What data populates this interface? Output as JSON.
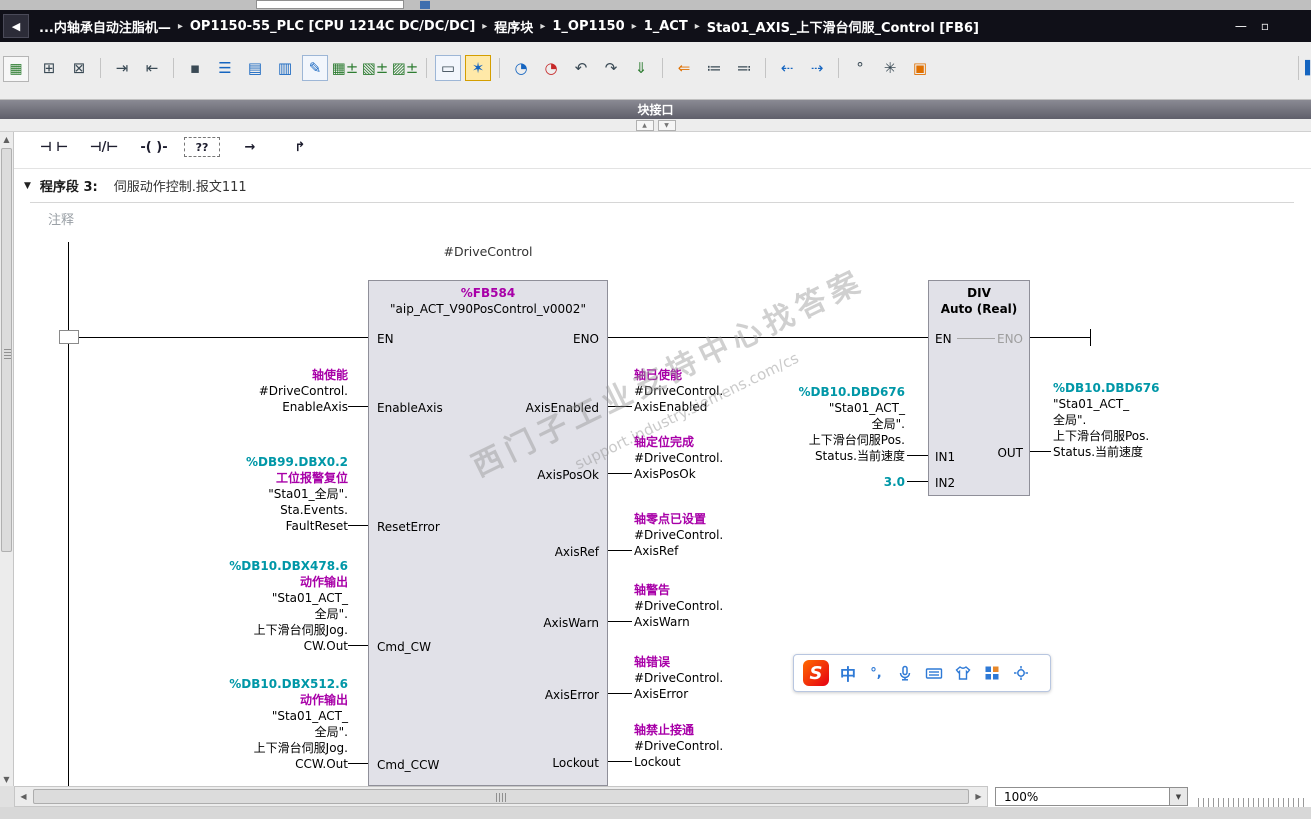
{
  "title_bar": {
    "back_icon": "◀",
    "separator": "▸",
    "breadcrumb": [
      "...内轴承自动注脂机—",
      "OP1150-55_PLC [CPU 1214C DC/DC/DC]",
      "程序块",
      "1_OP1150",
      "1_ACT",
      "Sta01_AXIS_上下滑台伺服_Control [FB6]"
    ],
    "minimize_label": "—",
    "maximize_label": "▫"
  },
  "toolbar": {
    "leading_icon": {
      "name": "program-editor-icon",
      "glyph": "▦",
      "color": "#2e7d32"
    },
    "overflow_icon": {
      "name": "toolbar-overflow-icon",
      "glyph": "▐",
      "color": "#1565c0"
    },
    "icons": [
      {
        "name": "insert-network-icon",
        "glyph": "⊞",
        "color": "#3a4a55"
      },
      {
        "name": "delete-network-icon",
        "glyph": "⊠",
        "color": "#3a4a55"
      },
      {
        "name": "insert-row-icon",
        "glyph": "⇥",
        "color": "#3a4a55"
      },
      {
        "name": "delete-row-icon",
        "glyph": "⇤",
        "color": "#3a4a55"
      },
      {
        "name": "reset-layout-icon",
        "glyph": "▪",
        "color": "#3a4a55"
      },
      {
        "name": "expand-all-networks-icon",
        "glyph": "☰",
        "color": "#1565c0"
      },
      {
        "name": "collapse-all-networks-icon",
        "glyph": "▤",
        "color": "#1565c0"
      },
      {
        "name": "absolute-symbolic-operands-icon",
        "glyph": "▥",
        "color": "#1565c0"
      },
      {
        "name": "toggle-network-comments-icon",
        "glyph": "✎",
        "color": "#1565c0"
      },
      {
        "name": "insert-fb-call-icon",
        "glyph": "▦±",
        "color": "#2e7d32"
      },
      {
        "name": "insert-fc-call-icon",
        "glyph": "▧±",
        "color": "#2e7d32"
      },
      {
        "name": "insert-db-call-icon",
        "glyph": "▨±",
        "color": "#2e7d32"
      },
      {
        "name": "insert-empty-box-icon",
        "glyph": "▭",
        "color": "#3a4a55"
      },
      {
        "name": "update-block-calls-icon",
        "glyph": "✶",
        "color": "#1565c0"
      },
      {
        "name": "monitoring-on-icon",
        "glyph": "◔",
        "color": "#1565c0"
      },
      {
        "name": "monitoring-off-icon",
        "glyph": "◔",
        "color": "#c62828"
      },
      {
        "name": "jump-backward-icon",
        "glyph": "↶",
        "color": "#3a4a55"
      },
      {
        "name": "jump-forward-icon",
        "glyph": "↷",
        "color": "#3a4a55"
      },
      {
        "name": "download-icon",
        "glyph": "⇓",
        "color": "#2e7d32"
      },
      {
        "name": "go-online-icon",
        "glyph": "⇐",
        "color": "#e07000"
      },
      {
        "name": "call-structure-icon",
        "glyph": "≔",
        "color": "#3a4a55"
      },
      {
        "name": "assignment-list-icon",
        "glyph": "≕",
        "color": "#3a4a55"
      },
      {
        "name": "previous-error-icon",
        "glyph": "⇠",
        "color": "#1565c0"
      },
      {
        "name": "next-error-icon",
        "glyph": "⇢",
        "color": "#1565c0"
      },
      {
        "name": "settings-icon",
        "glyph": "°",
        "color": "#3a4a55"
      },
      {
        "name": "snapshot-icon",
        "glyph": "✳",
        "color": "#3a4a55"
      },
      {
        "name": "know-how-protection-icon",
        "glyph": "▣",
        "color": "#e07000"
      }
    ]
  },
  "block_interface_bar": {
    "label": "块接口",
    "handle_up": "▲",
    "handle_down": "▼"
  },
  "lad_toolbar": {
    "items": [
      {
        "name": "no-contact-icon",
        "glyph": "⊣ ⊢"
      },
      {
        "name": "nc-contact-icon",
        "glyph": "⊣/⊢"
      },
      {
        "name": "coil-icon",
        "glyph": "-( )-"
      },
      {
        "name": "empty-box-icon",
        "glyph": "??"
      },
      {
        "name": "open-branch-icon",
        "glyph": "→"
      },
      {
        "name": "close-branch-icon",
        "glyph": "↱"
      }
    ]
  },
  "network": {
    "collapse_icon": "▼",
    "number_label": "程序段 3:",
    "title": "伺服动作控制.报文111",
    "comment_placeholder": "注释"
  },
  "diagram": {
    "instance_label": "#DriveControl",
    "fb": {
      "number": "%FB584",
      "name": "\"aip_ACT_V90PosControl_v0002\"",
      "pin_en": "EN",
      "pin_eno": "ENO",
      "pins_left": [
        "EnableAxis",
        "ResetError",
        "Cmd_CW",
        "Cmd_CCW"
      ],
      "pins_right": [
        "AxisEnabled",
        "AxisPosOk",
        "AxisRef",
        "AxisWarn",
        "AxisError",
        "Lockout"
      ]
    },
    "left_operands": [
      {
        "lines": [
          {
            "t": "轴使能",
            "k": "cmt"
          },
          {
            "t": "#DriveControl.",
            "k": "sym"
          },
          {
            "t": "EnableAxis",
            "k": "sym"
          }
        ]
      },
      {
        "lines": [
          {
            "t": "%DB99.DBX0.2",
            "k": "addr"
          },
          {
            "t": "工位报警复位",
            "k": "cmt"
          },
          {
            "t": "\"Sta01_全局\".",
            "k": "sym"
          },
          {
            "t": "Sta.Events.",
            "k": "sym"
          },
          {
            "t": "FaultReset",
            "k": "sym"
          }
        ]
      },
      {
        "lines": [
          {
            "t": "%DB10.DBX478.6",
            "k": "addr"
          },
          {
            "t": "动作输出",
            "k": "cmt"
          },
          {
            "t": "\"Sta01_ACT_",
            "k": "sym"
          },
          {
            "t": "全局\".",
            "k": "sym"
          },
          {
            "t": "上下滑台伺服Jog.",
            "k": "sym"
          },
          {
            "t": "CW.Out",
            "k": "sym"
          }
        ]
      },
      {
        "lines": [
          {
            "t": "%DB10.DBX512.6",
            "k": "addr"
          },
          {
            "t": "动作输出",
            "k": "cmt"
          },
          {
            "t": "\"Sta01_ACT_",
            "k": "sym"
          },
          {
            "t": "全局\".",
            "k": "sym"
          },
          {
            "t": "上下滑台伺服Jog.",
            "k": "sym"
          },
          {
            "t": "CCW.Out",
            "k": "sym"
          }
        ]
      }
    ],
    "right_operands": [
      {
        "lines": [
          {
            "t": "轴已使能",
            "k": "cmt"
          },
          {
            "t": "#DriveControl.",
            "k": "sym"
          },
          {
            "t": "AxisEnabled",
            "k": "sym"
          }
        ]
      },
      {
        "lines": [
          {
            "t": "轴定位完成",
            "k": "cmt"
          },
          {
            "t": "#DriveControl.",
            "k": "sym"
          },
          {
            "t": "AxisPosOk",
            "k": "sym"
          }
        ]
      },
      {
        "lines": [
          {
            "t": "轴零点已设置",
            "k": "cmt"
          },
          {
            "t": "#DriveControl.",
            "k": "sym"
          },
          {
            "t": "AxisRef",
            "k": "sym"
          }
        ]
      },
      {
        "lines": [
          {
            "t": "轴警告",
            "k": "cmt"
          },
          {
            "t": "#DriveControl.",
            "k": "sym"
          },
          {
            "t": "AxisWarn",
            "k": "sym"
          }
        ]
      },
      {
        "lines": [
          {
            "t": "轴错误",
            "k": "cmt"
          },
          {
            "t": "#DriveControl.",
            "k": "sym"
          },
          {
            "t": "AxisError",
            "k": "sym"
          }
        ]
      },
      {
        "lines": [
          {
            "t": "轴禁止接通",
            "k": "cmt"
          },
          {
            "t": "#DriveControl.",
            "k": "sym"
          },
          {
            "t": "Lockout",
            "k": "sym"
          }
        ]
      }
    ],
    "div_block": {
      "title": "DIV",
      "subtitle": "Auto (Real)",
      "pin_en": "EN",
      "pin_eno": "ENO",
      "pin_in1": "IN1",
      "pin_in2": "IN2",
      "pin_out": "OUT",
      "in2_value": "3.0"
    },
    "div_in1_operand": {
      "lines": [
        {
          "t": "%DB10.DBD676",
          "k": "addr"
        },
        {
          "t": "\"Sta01_ACT_",
          "k": "sym"
        },
        {
          "t": "全局\".",
          "k": "sym"
        },
        {
          "t": "上下滑台伺服Pos.",
          "k": "sym"
        },
        {
          "t": "Status.当前速度",
          "k": "sym"
        }
      ]
    },
    "div_out_operand": {
      "lines": [
        {
          "t": "%DB10.DBD676",
          "k": "addr"
        },
        {
          "t": "\"Sta01_ACT_",
          "k": "sym"
        },
        {
          "t": "全局\".",
          "k": "sym"
        },
        {
          "t": "上下滑台伺服Pos.",
          "k": "sym"
        },
        {
          "t": "Status.当前速度",
          "k": "sym"
        }
      ]
    },
    "watermark": {
      "line1": "西门子工业支持中心找答案",
      "line2": "support.industry.siemens.com/cs"
    }
  },
  "ime": {
    "logo": "S",
    "mode": "中",
    "punctuation": "°,"
  },
  "scrollbars": {
    "up": "▲",
    "down": "▼",
    "left": "◀",
    "right": "▶"
  },
  "status_bar": {
    "zoom": "100%",
    "dropdown_icon": "▼"
  },
  "colors": {
    "address": "#0097a7",
    "comment": "#a800a8",
    "fb_number": "#a800a8",
    "wire": "#000000",
    "accent_blue": "#1565c0",
    "ime_blue": "#2f7ad6"
  }
}
